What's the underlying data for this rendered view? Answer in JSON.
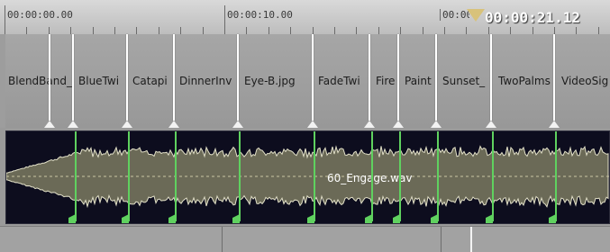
{
  "ruler": {
    "timecodes": [
      "00:00:00.00",
      "00:00:10.00",
      "00:00:20.00"
    ],
    "playhead_time": "00:00:21.12"
  },
  "video_track": {
    "clips": [
      "BlendBand_",
      "BlueTwi",
      "Catapi",
      "DinnerInv",
      "Eye-B.jpg",
      "FadeTwi",
      "Fire",
      "Paint",
      "Sunset_",
      "TwoPalms",
      "VideoSig"
    ]
  },
  "audio_track": {
    "clip_label": "60_Engage.wav",
    "colors": {
      "waveform": "#e2e0c8",
      "marker": "#5fd15f",
      "background": "#0d0d1e"
    }
  }
}
